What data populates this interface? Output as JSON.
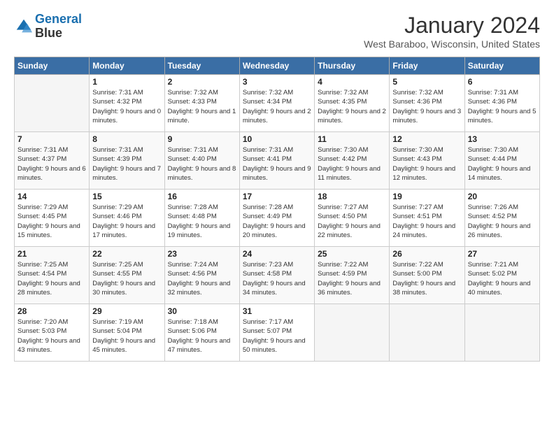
{
  "header": {
    "logo_line1": "General",
    "logo_line2": "Blue",
    "month_title": "January 2024",
    "location": "West Baraboo, Wisconsin, United States"
  },
  "days_of_week": [
    "Sunday",
    "Monday",
    "Tuesday",
    "Wednesday",
    "Thursday",
    "Friday",
    "Saturday"
  ],
  "weeks": [
    [
      {
        "num": "",
        "empty": true
      },
      {
        "num": "1",
        "sunrise": "7:31 AM",
        "sunset": "4:32 PM",
        "daylight": "9 hours and 0 minutes."
      },
      {
        "num": "2",
        "sunrise": "7:32 AM",
        "sunset": "4:33 PM",
        "daylight": "9 hours and 1 minute."
      },
      {
        "num": "3",
        "sunrise": "7:32 AM",
        "sunset": "4:34 PM",
        "daylight": "9 hours and 2 minutes."
      },
      {
        "num": "4",
        "sunrise": "7:32 AM",
        "sunset": "4:35 PM",
        "daylight": "9 hours and 2 minutes."
      },
      {
        "num": "5",
        "sunrise": "7:32 AM",
        "sunset": "4:36 PM",
        "daylight": "9 hours and 3 minutes."
      },
      {
        "num": "6",
        "sunrise": "7:31 AM",
        "sunset": "4:36 PM",
        "daylight": "9 hours and 5 minutes."
      }
    ],
    [
      {
        "num": "7",
        "sunrise": "7:31 AM",
        "sunset": "4:37 PM",
        "daylight": "9 hours and 6 minutes."
      },
      {
        "num": "8",
        "sunrise": "7:31 AM",
        "sunset": "4:39 PM",
        "daylight": "9 hours and 7 minutes."
      },
      {
        "num": "9",
        "sunrise": "7:31 AM",
        "sunset": "4:40 PM",
        "daylight": "9 hours and 8 minutes."
      },
      {
        "num": "10",
        "sunrise": "7:31 AM",
        "sunset": "4:41 PM",
        "daylight": "9 hours and 9 minutes."
      },
      {
        "num": "11",
        "sunrise": "7:30 AM",
        "sunset": "4:42 PM",
        "daylight": "9 hours and 11 minutes."
      },
      {
        "num": "12",
        "sunrise": "7:30 AM",
        "sunset": "4:43 PM",
        "daylight": "9 hours and 12 minutes."
      },
      {
        "num": "13",
        "sunrise": "7:30 AM",
        "sunset": "4:44 PM",
        "daylight": "9 hours and 14 minutes."
      }
    ],
    [
      {
        "num": "14",
        "sunrise": "7:29 AM",
        "sunset": "4:45 PM",
        "daylight": "9 hours and 15 minutes."
      },
      {
        "num": "15",
        "sunrise": "7:29 AM",
        "sunset": "4:46 PM",
        "daylight": "9 hours and 17 minutes."
      },
      {
        "num": "16",
        "sunrise": "7:28 AM",
        "sunset": "4:48 PM",
        "daylight": "9 hours and 19 minutes."
      },
      {
        "num": "17",
        "sunrise": "7:28 AM",
        "sunset": "4:49 PM",
        "daylight": "9 hours and 20 minutes."
      },
      {
        "num": "18",
        "sunrise": "7:27 AM",
        "sunset": "4:50 PM",
        "daylight": "9 hours and 22 minutes."
      },
      {
        "num": "19",
        "sunrise": "7:27 AM",
        "sunset": "4:51 PM",
        "daylight": "9 hours and 24 minutes."
      },
      {
        "num": "20",
        "sunrise": "7:26 AM",
        "sunset": "4:52 PM",
        "daylight": "9 hours and 26 minutes."
      }
    ],
    [
      {
        "num": "21",
        "sunrise": "7:25 AM",
        "sunset": "4:54 PM",
        "daylight": "9 hours and 28 minutes."
      },
      {
        "num": "22",
        "sunrise": "7:25 AM",
        "sunset": "4:55 PM",
        "daylight": "9 hours and 30 minutes."
      },
      {
        "num": "23",
        "sunrise": "7:24 AM",
        "sunset": "4:56 PM",
        "daylight": "9 hours and 32 minutes."
      },
      {
        "num": "24",
        "sunrise": "7:23 AM",
        "sunset": "4:58 PM",
        "daylight": "9 hours and 34 minutes."
      },
      {
        "num": "25",
        "sunrise": "7:22 AM",
        "sunset": "4:59 PM",
        "daylight": "9 hours and 36 minutes."
      },
      {
        "num": "26",
        "sunrise": "7:22 AM",
        "sunset": "5:00 PM",
        "daylight": "9 hours and 38 minutes."
      },
      {
        "num": "27",
        "sunrise": "7:21 AM",
        "sunset": "5:02 PM",
        "daylight": "9 hours and 40 minutes."
      }
    ],
    [
      {
        "num": "28",
        "sunrise": "7:20 AM",
        "sunset": "5:03 PM",
        "daylight": "9 hours and 43 minutes."
      },
      {
        "num": "29",
        "sunrise": "7:19 AM",
        "sunset": "5:04 PM",
        "daylight": "9 hours and 45 minutes."
      },
      {
        "num": "30",
        "sunrise": "7:18 AM",
        "sunset": "5:06 PM",
        "daylight": "9 hours and 47 minutes."
      },
      {
        "num": "31",
        "sunrise": "7:17 AM",
        "sunset": "5:07 PM",
        "daylight": "9 hours and 50 minutes."
      },
      {
        "num": "",
        "empty": true
      },
      {
        "num": "",
        "empty": true
      },
      {
        "num": "",
        "empty": true
      }
    ]
  ]
}
